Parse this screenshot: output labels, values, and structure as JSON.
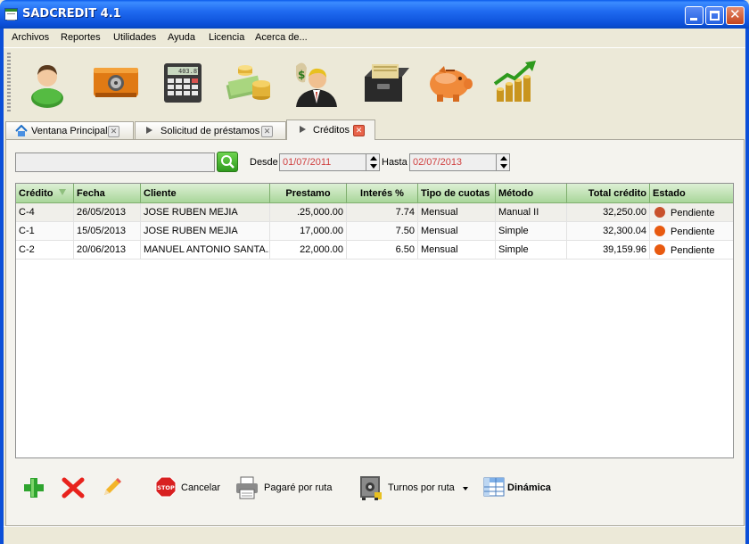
{
  "window": {
    "title": "SADCREDIT 4.1"
  },
  "menu": [
    "Archivos",
    "Reportes",
    "Utilidades",
    "Ayuda",
    "Licencia",
    "Acerca de..."
  ],
  "toolbar": {
    "icons": [
      "client-icon",
      "safe-drawer-icon",
      "calculator-icon",
      "money-stack-icon",
      "businessman-money-icon",
      "file-drawer-icon",
      "piggy-bank-icon",
      "coin-growth-icon"
    ],
    "calculator_display": "403.87"
  },
  "tabs": [
    {
      "label": "Ventana Principal",
      "active": false
    },
    {
      "label": "Solicitud de préstamos",
      "active": false
    },
    {
      "label": "Créditos",
      "active": true
    }
  ],
  "filters": {
    "search_value": "",
    "desde_label": "Desde",
    "desde_value": "01/07/2011",
    "hasta_label": "Hasta",
    "hasta_value": "02/07/2013"
  },
  "table": {
    "columns": [
      "Crédito",
      "Fecha",
      "Cliente",
      "Prestamo",
      "Interés %",
      "Tipo de cuotas",
      "Método",
      "Total crédito",
      "Estado"
    ],
    "rows": [
      {
        "credito": "C-4",
        "fecha": "26/05/2013",
        "cliente": "JOSE RUBEN MEJIA",
        "prestamo": ".25,000.00",
        "interes": "7.74",
        "tipo": "Mensual",
        "metodo": "Manual II",
        "total": "32,250.00",
        "estado": "Pendiente",
        "status_color": "#C8512C"
      },
      {
        "credito": "C-1",
        "fecha": "15/05/2013",
        "cliente": "JOSE RUBEN MEJIA",
        "prestamo": "17,000.00",
        "interes": "7.50",
        "tipo": "Mensual",
        "metodo": "Simple",
        "total": "32,300.04",
        "estado": "Pendiente",
        "status_color": "#E85A10"
      },
      {
        "credito": "C-2",
        "fecha": "20/06/2013",
        "cliente": "MANUEL ANTONIO SANTA...",
        "prestamo": "22,000.00",
        "interes": "6.50",
        "tipo": "Mensual",
        "metodo": "Simple",
        "total": "39,159.96",
        "estado": "Pendiente",
        "status_color": "#E85A10"
      }
    ]
  },
  "actions": {
    "cancel_label": "Cancelar",
    "pagare_label": "Pagaré por ruta",
    "turnos_label": "Turnos por ruta",
    "dinamica_label": "Dinámica"
  },
  "colors": {
    "titlebar": "#0B4FD8",
    "header_green": "#A9D69A",
    "date_text": "#D04040",
    "status_orange": "#E85A10"
  }
}
